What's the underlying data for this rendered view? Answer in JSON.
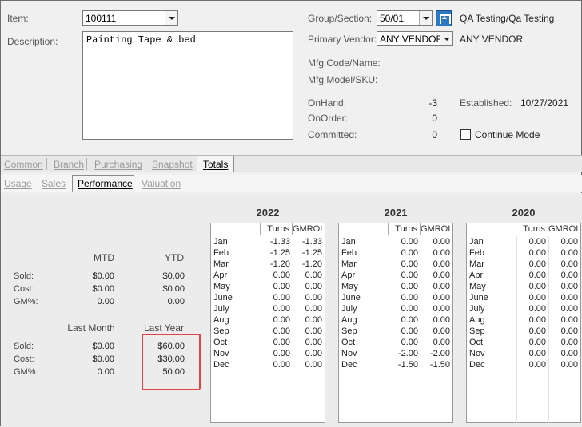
{
  "form": {
    "item_label": "Item:",
    "item_value": "100111",
    "description_label": "Description:",
    "description_value": "Painting Tape & bed",
    "group_label": "Group/Section:",
    "group_value": "50/01",
    "group_name": "QA Testing/Qa Testing",
    "vendor_label": "Primary Vendor:",
    "vendor_value": "ANY VENDOR",
    "vendor_name": "ANY VENDOR",
    "mfg_code_label": "Mfg Code/Name:",
    "mfg_model_label": "Mfg Model/SKU:",
    "onhand_label": "OnHand:",
    "onhand_value": "-3",
    "onorder_label": "OnOrder:",
    "onorder_value": "0",
    "committed_label": "Committed:",
    "committed_value": "0",
    "established_label": "Established:",
    "established_value": "10/27/2021",
    "continue_mode_label": "Continue Mode",
    "continue_mode_checked": false
  },
  "tabs_main": [
    {
      "label": "Common",
      "active": false
    },
    {
      "label": "Branch",
      "active": false
    },
    {
      "label": "Purchasing",
      "active": false
    },
    {
      "label": "Snapshot",
      "active": false
    },
    {
      "label": "Totals",
      "active": true
    }
  ],
  "tabs_sub": [
    {
      "label": "Usage",
      "active": false
    },
    {
      "label": "Sales",
      "active": false
    },
    {
      "label": "Performance",
      "active": true
    },
    {
      "label": "Valuation",
      "active": false
    }
  ],
  "performance": {
    "mtd_header": "MTD",
    "ytd_header": "YTD",
    "last_month_header": "Last Month",
    "last_year_header": "Last Year",
    "sold_label": "Sold:",
    "cost_label": "Cost:",
    "gm_label": "GM%:",
    "mtd": {
      "sold": "$0.00",
      "cost": "$0.00",
      "gm": "0.00"
    },
    "ytd": {
      "sold": "$0.00",
      "cost": "$0.00",
      "gm": "0.00"
    },
    "last_month": {
      "sold": "$0.00",
      "cost": "$0.00",
      "gm": "0.00"
    },
    "last_year": {
      "sold": "$60.00",
      "cost": "$30.00",
      "gm": "50.00"
    }
  },
  "grid_headers": {
    "turns": "Turns",
    "gmroi": "GMROI"
  },
  "years": [
    {
      "year": "2022",
      "rows": [
        {
          "month": "Jan",
          "turns": "-1.33",
          "gmroi": "-1.33"
        },
        {
          "month": "Feb",
          "turns": "-1.25",
          "gmroi": "-1.25"
        },
        {
          "month": "Mar",
          "turns": "-1.20",
          "gmroi": "-1.20"
        },
        {
          "month": "Apr",
          "turns": "0.00",
          "gmroi": "0.00"
        },
        {
          "month": "May",
          "turns": "0.00",
          "gmroi": "0.00"
        },
        {
          "month": "June",
          "turns": "0.00",
          "gmroi": "0.00"
        },
        {
          "month": "July",
          "turns": "0.00",
          "gmroi": "0.00"
        },
        {
          "month": "Aug",
          "turns": "0.00",
          "gmroi": "0.00"
        },
        {
          "month": "Sep",
          "turns": "0.00",
          "gmroi": "0.00"
        },
        {
          "month": "Oct",
          "turns": "0.00",
          "gmroi": "0.00"
        },
        {
          "month": "Nov",
          "turns": "0.00",
          "gmroi": "0.00"
        },
        {
          "month": "Dec",
          "turns": "0.00",
          "gmroi": "0.00"
        }
      ]
    },
    {
      "year": "2021",
      "rows": [
        {
          "month": "Jan",
          "turns": "0.00",
          "gmroi": "0.00"
        },
        {
          "month": "Feb",
          "turns": "0.00",
          "gmroi": "0.00"
        },
        {
          "month": "Mar",
          "turns": "0.00",
          "gmroi": "0.00"
        },
        {
          "month": "Apr",
          "turns": "0.00",
          "gmroi": "0.00"
        },
        {
          "month": "May",
          "turns": "0.00",
          "gmroi": "0.00"
        },
        {
          "month": "June",
          "turns": "0.00",
          "gmroi": "0.00"
        },
        {
          "month": "July",
          "turns": "0.00",
          "gmroi": "0.00"
        },
        {
          "month": "Aug",
          "turns": "0.00",
          "gmroi": "0.00"
        },
        {
          "month": "Sep",
          "turns": "0.00",
          "gmroi": "0.00"
        },
        {
          "month": "Oct",
          "turns": "0.00",
          "gmroi": "0.00"
        },
        {
          "month": "Nov",
          "turns": "-2.00",
          "gmroi": "-2.00"
        },
        {
          "month": "Dec",
          "turns": "-1.50",
          "gmroi": "-1.50"
        }
      ]
    },
    {
      "year": "2020",
      "rows": [
        {
          "month": "Jan",
          "turns": "0.00",
          "gmroi": "0.00"
        },
        {
          "month": "Feb",
          "turns": "0.00",
          "gmroi": "0.00"
        },
        {
          "month": "Mar",
          "turns": "0.00",
          "gmroi": "0.00"
        },
        {
          "month": "Apr",
          "turns": "0.00",
          "gmroi": "0.00"
        },
        {
          "month": "May",
          "turns": "0.00",
          "gmroi": "0.00"
        },
        {
          "month": "June",
          "turns": "0.00",
          "gmroi": "0.00"
        },
        {
          "month": "July",
          "turns": "0.00",
          "gmroi": "0.00"
        },
        {
          "month": "Aug",
          "turns": "0.00",
          "gmroi": "0.00"
        },
        {
          "month": "Sep",
          "turns": "0.00",
          "gmroi": "0.00"
        },
        {
          "month": "Oct",
          "turns": "0.00",
          "gmroi": "0.00"
        },
        {
          "month": "Nov",
          "turns": "0.00",
          "gmroi": "0.00"
        },
        {
          "month": "Dec",
          "turns": "0.00",
          "gmroi": "0.00"
        }
      ]
    }
  ],
  "highlight_color": "#e04545"
}
